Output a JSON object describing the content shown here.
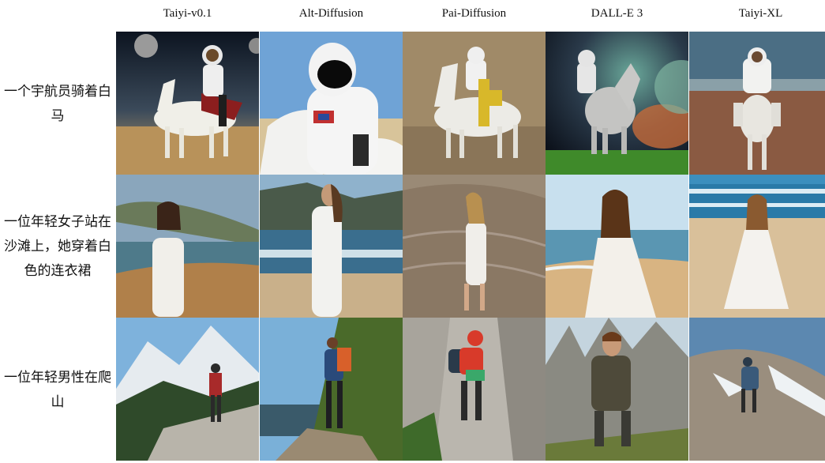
{
  "models": [
    "Taiyi-v0.1",
    "Alt-Diffusion",
    "Pai-Diffusion",
    "DALL-E 3",
    "Taiyi-XL"
  ],
  "prompts": [
    "一个宇航员骑着白马",
    "一位年轻女子站在沙滩上，她穿着白色的连衣裙",
    "一位年轻男性在爬山"
  ],
  "prompt_lines": [
    [
      "一个宇航员骑着白",
      "马"
    ],
    [
      "一位年轻女子站在",
      "沙滩上，她穿着白",
      "色的连衣裙"
    ],
    [
      "一位年轻男性在爬",
      "山"
    ]
  ]
}
